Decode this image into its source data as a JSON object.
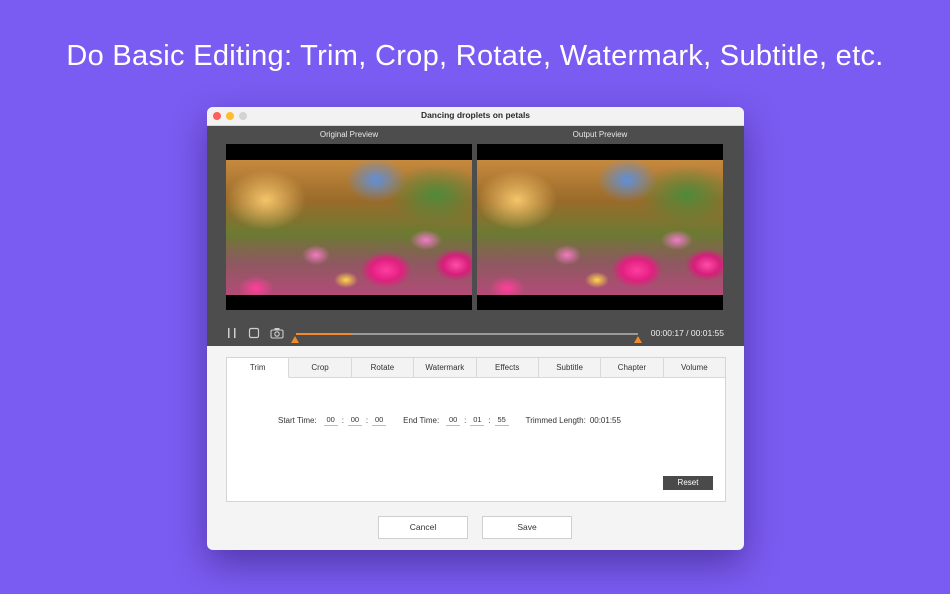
{
  "headline": "Do Basic Editing: Trim, Crop, Rotate, Watermark, Subtitle, etc.",
  "window": {
    "title": "Dancing droplets on petals"
  },
  "preview": {
    "original_label": "Original Preview",
    "output_label": "Output Preview"
  },
  "playback": {
    "time": "00:00:17 / 00:01:55",
    "progress_fraction": 0.16
  },
  "tabs": [
    {
      "label": "Trim",
      "active": true
    },
    {
      "label": "Crop"
    },
    {
      "label": "Rotate"
    },
    {
      "label": "Watermark"
    },
    {
      "label": "Effects"
    },
    {
      "label": "Subtitle"
    },
    {
      "label": "Chapter"
    },
    {
      "label": "Volume"
    }
  ],
  "trim": {
    "start_label": "Start Time:",
    "start": [
      "00",
      "00",
      "00"
    ],
    "end_label": "End Time:",
    "end": [
      "00",
      "01",
      "55"
    ],
    "length_label": "Trimmed Length:",
    "length_value": "00:01:55",
    "reset_label": "Reset"
  },
  "buttons": {
    "cancel": "Cancel",
    "save": "Save"
  },
  "colors": {
    "background": "#7b5cf2",
    "accent": "#f08a2a"
  }
}
